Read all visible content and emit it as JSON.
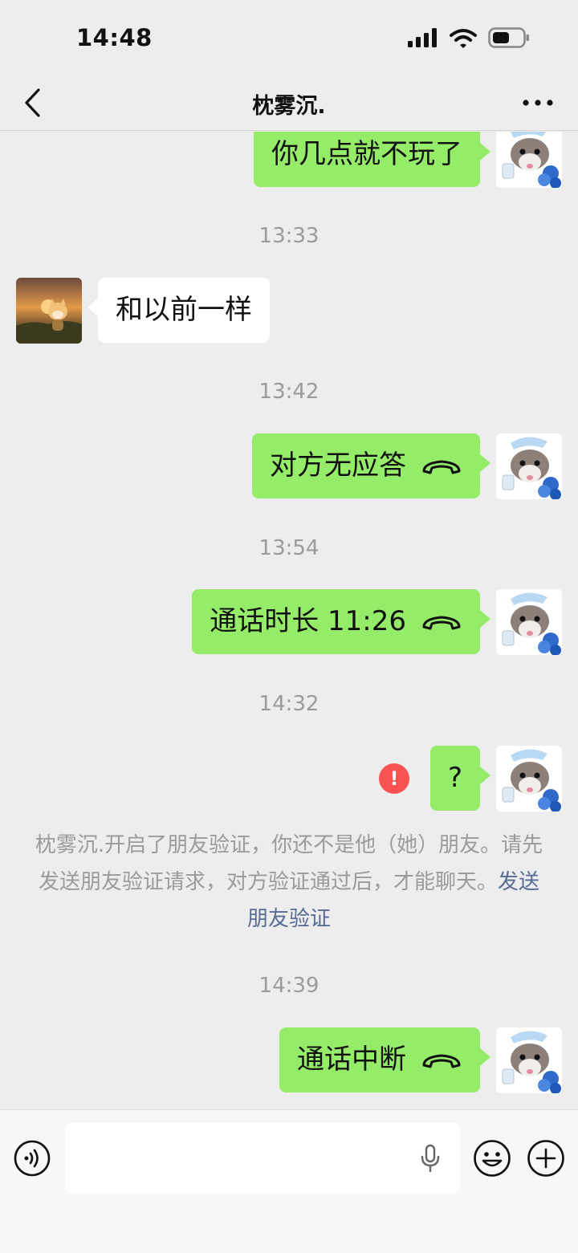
{
  "status_bar": {
    "time": "14:48"
  },
  "nav": {
    "title": "枕雾沉."
  },
  "messages": {
    "m1": {
      "text": "你几点就不玩了"
    },
    "t1": "13:33",
    "m2": {
      "text": "和以前一样"
    },
    "t2": "13:42",
    "m3": {
      "text": "对方无应答"
    },
    "t3": "13:54",
    "m4": {
      "text": "通话时长 11:26"
    },
    "t4": "14:32",
    "m5": {
      "text": "?",
      "error_mark": "!"
    },
    "notice": {
      "text": "枕雾沉.开启了朋友验证，你还不是他（她）朋友。请先发送朋友验证请求，对方验证通过后，才能聊天。",
      "link": "发送朋友验证"
    },
    "t5": "14:39",
    "m6": {
      "text": "通话中断"
    }
  },
  "icons": {
    "back": "chevron-left-icon",
    "more": "more-dots-icon",
    "call": "phone-hangup-icon",
    "voice": "voice-mode-icon",
    "mic": "microphone-icon",
    "emoji": "emoji-icon",
    "plus": "plus-icon"
  },
  "colors": {
    "background": "#ededed",
    "sent_bubble": "#95ec69",
    "received_bubble": "#ffffff",
    "link": "#576b95",
    "error": "#fa5151",
    "timestamp": "#9b9b9b"
  }
}
